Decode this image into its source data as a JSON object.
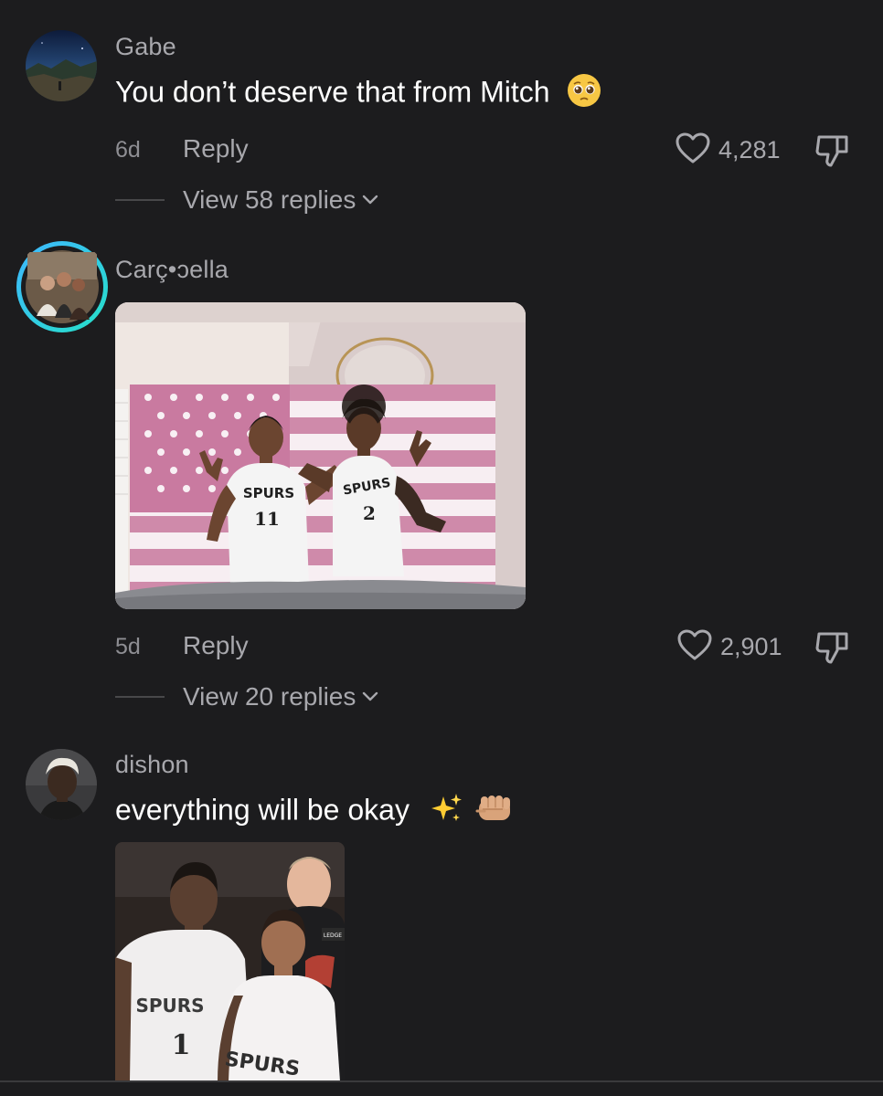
{
  "comments": [
    {
      "username": "Gabe",
      "text": "You don’t deserve that from Mitch",
      "emoji": "pleading-face-emoji",
      "time": "6d",
      "reply_label": "Reply",
      "likes": "4,281",
      "view_replies": "View 58 replies"
    },
    {
      "username": "Carç•ɔella",
      "time": "5d",
      "reply_label": "Reply",
      "likes": "2,901",
      "view_replies": "View 20 replies",
      "image": {
        "left_jersey_team": "SPURS",
        "left_jersey_number": "11",
        "right_jersey_team": "SPURS",
        "right_jersey_number": "2"
      }
    },
    {
      "username": "dishon",
      "text": "everything will be okay",
      "emojis": [
        "sparkles-emoji",
        "fist-bump-emoji"
      ],
      "image": {
        "left_jersey_team": "SPURS",
        "left_jersey_number": "1",
        "right_jersey_team": "SPURS",
        "badge_text": "LEDGE"
      }
    }
  ],
  "icons": {
    "like": "heart-outline-icon",
    "dislike": "thumbs-down-icon",
    "expand": "chevron-down-icon"
  },
  "colors": {
    "background": "#1c1c1e",
    "secondary_text": "#a8a8ad",
    "primary_text": "#ffffff",
    "story_ring": "#2ec4f0"
  }
}
